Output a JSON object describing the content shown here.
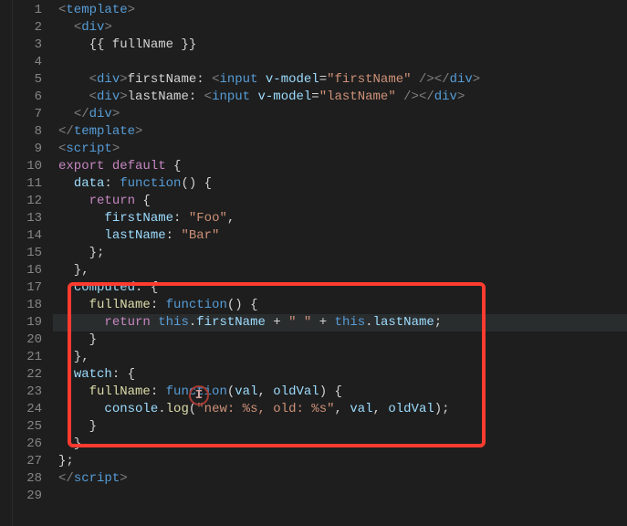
{
  "lineCount": 29,
  "highlightLine": 19,
  "styleMap": {
    "t": "t-tag",
    "n": "t-name",
    "a": "t-attr",
    "s": "t-str",
    "f": "t-fun",
    "k": "t-kw",
    "p": "t-kw2",
    "x": "t-txt",
    "r": "t-prop",
    "u": "t-punct"
  },
  "code": [
    [
      [
        "t",
        "<"
      ],
      [
        "n",
        "template"
      ],
      [
        "t",
        ">"
      ]
    ],
    [
      [
        "x",
        "  "
      ],
      [
        "t",
        "<"
      ],
      [
        "n",
        "div"
      ],
      [
        "t",
        ">"
      ]
    ],
    [
      [
        "x",
        "    {{ fullName }}"
      ]
    ],
    [],
    [
      [
        "x",
        "    "
      ],
      [
        "t",
        "<"
      ],
      [
        "n",
        "div"
      ],
      [
        "t",
        ">"
      ],
      [
        "x",
        "firstName: "
      ],
      [
        "t",
        "<"
      ],
      [
        "n",
        "input"
      ],
      [
        "x",
        " "
      ],
      [
        "a",
        "v-model"
      ],
      [
        "x",
        "="
      ],
      [
        "s",
        "\"firstName\""
      ],
      [
        "x",
        " "
      ],
      [
        "t",
        "/>"
      ],
      [
        "t",
        "</"
      ],
      [
        "n",
        "div"
      ],
      [
        "t",
        ">"
      ]
    ],
    [
      [
        "x",
        "    "
      ],
      [
        "t",
        "<"
      ],
      [
        "n",
        "div"
      ],
      [
        "t",
        ">"
      ],
      [
        "x",
        "lastName: "
      ],
      [
        "t",
        "<"
      ],
      [
        "n",
        "input"
      ],
      [
        "x",
        " "
      ],
      [
        "a",
        "v-model"
      ],
      [
        "x",
        "="
      ],
      [
        "s",
        "\"lastName\""
      ],
      [
        "x",
        " "
      ],
      [
        "t",
        "/>"
      ],
      [
        "t",
        "</"
      ],
      [
        "n",
        "div"
      ],
      [
        "t",
        ">"
      ]
    ],
    [
      [
        "x",
        "  "
      ],
      [
        "t",
        "</"
      ],
      [
        "n",
        "div"
      ],
      [
        "t",
        ">"
      ]
    ],
    [
      [
        "t",
        "</"
      ],
      [
        "n",
        "template"
      ],
      [
        "t",
        ">"
      ]
    ],
    [
      [
        "t",
        "<"
      ],
      [
        "n",
        "script"
      ],
      [
        "t",
        ">"
      ]
    ],
    [
      [
        "p",
        "export"
      ],
      [
        "x",
        " "
      ],
      [
        "p",
        "default"
      ],
      [
        "x",
        " {"
      ]
    ],
    [
      [
        "x",
        "  "
      ],
      [
        "r",
        "data"
      ],
      [
        "x",
        ": "
      ],
      [
        "k",
        "function"
      ],
      [
        "x",
        "() {"
      ]
    ],
    [
      [
        "x",
        "    "
      ],
      [
        "p",
        "return"
      ],
      [
        "x",
        " {"
      ]
    ],
    [
      [
        "x",
        "      "
      ],
      [
        "r",
        "firstName"
      ],
      [
        "x",
        ": "
      ],
      [
        "s",
        "\"Foo\""
      ],
      [
        "x",
        ","
      ]
    ],
    [
      [
        "x",
        "      "
      ],
      [
        "r",
        "lastName"
      ],
      [
        "x",
        ": "
      ],
      [
        "s",
        "\"Bar\""
      ]
    ],
    [
      [
        "x",
        "    };"
      ]
    ],
    [
      [
        "x",
        "  },"
      ]
    ],
    [
      [
        "x",
        "  "
      ],
      [
        "r",
        "computed"
      ],
      [
        "x",
        ": {"
      ]
    ],
    [
      [
        "x",
        "    "
      ],
      [
        "f",
        "fullName"
      ],
      [
        "x",
        ": "
      ],
      [
        "k",
        "function"
      ],
      [
        "x",
        "() {"
      ]
    ],
    [
      [
        "x",
        "      "
      ],
      [
        "p",
        "return"
      ],
      [
        "x",
        " "
      ],
      [
        "k",
        "this"
      ],
      [
        "x",
        "."
      ],
      [
        "r",
        "firstName"
      ],
      [
        "x",
        " + "
      ],
      [
        "s",
        "\" \""
      ],
      [
        "x",
        " + "
      ],
      [
        "k",
        "this"
      ],
      [
        "x",
        "."
      ],
      [
        "r",
        "lastName"
      ],
      [
        "x",
        ";"
      ]
    ],
    [
      [
        "x",
        "    }"
      ]
    ],
    [
      [
        "x",
        "  },"
      ]
    ],
    [
      [
        "x",
        "  "
      ],
      [
        "r",
        "watch"
      ],
      [
        "x",
        ": {"
      ]
    ],
    [
      [
        "x",
        "    "
      ],
      [
        "f",
        "fullName"
      ],
      [
        "x",
        ": "
      ],
      [
        "k",
        "function"
      ],
      [
        "x",
        "("
      ],
      [
        "r",
        "val"
      ],
      [
        "x",
        ", "
      ],
      [
        "r",
        "oldVal"
      ],
      [
        "x",
        ") {"
      ]
    ],
    [
      [
        "x",
        "      "
      ],
      [
        "r",
        "console"
      ],
      [
        "x",
        "."
      ],
      [
        "f",
        "log"
      ],
      [
        "x",
        "("
      ],
      [
        "s",
        "\"new: %s, old: %s\""
      ],
      [
        "x",
        ", "
      ],
      [
        "r",
        "val"
      ],
      [
        "x",
        ", "
      ],
      [
        "r",
        "oldVal"
      ],
      [
        "x",
        ");"
      ]
    ],
    [
      [
        "x",
        "    }"
      ]
    ],
    [
      [
        "x",
        "  }"
      ]
    ],
    [
      [
        "x",
        "};"
      ]
    ],
    [
      [
        "t",
        "</"
      ],
      [
        "n",
        "script"
      ],
      [
        "t",
        ">"
      ]
    ],
    []
  ]
}
